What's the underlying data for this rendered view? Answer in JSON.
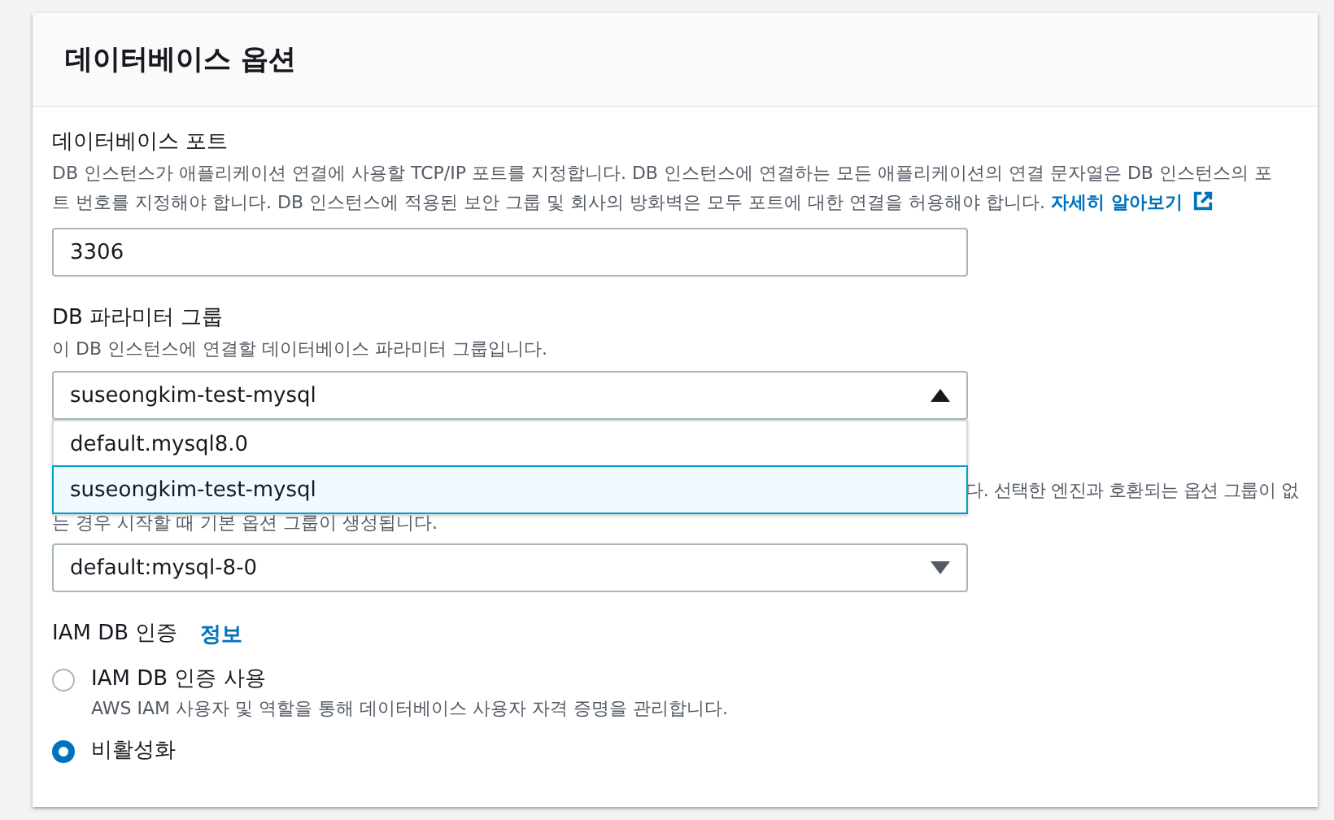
{
  "header": {
    "title": "데이터베이스 옵션"
  },
  "port": {
    "label": "데이터베이스 포트",
    "description": "DB 인스턴스가 애플리케이션 연결에 사용할 TCP/IP 포트를 지정합니다. DB 인스턴스에 연결하는 모든 애플리케이션의 연결 문자열은 DB 인스턴스의 포트 번호를 지정해야 합니다. DB 인스턴스에 적용된 보안 그룹 및 회사의 방화벽은 모두 포트에 대한 연결을 허용해야 합니다.",
    "link": "자세히 알아보기",
    "value": "3306"
  },
  "parameter_group": {
    "label": "DB 파라미터 그룹",
    "description": "이 DB 인스턴스에 연결할 데이터베이스 파라미터 그룹입니다.",
    "value": "suseongkim-test-mysql",
    "expanded": true,
    "options": [
      {
        "label": "default.mysql8.0",
        "selected": false
      },
      {
        "label": "suseongkim-test-mysql",
        "selected": true
      }
    ]
  },
  "option_group": {
    "description_fragments": [
      "다. 선택한 엔진과 호환되는 옵션 그룹이 없",
      "는 경우 시작할 때 기본 옵션 그룹이 생성됩니다."
    ],
    "value": "default:mysql-8-0",
    "expanded": false
  },
  "iam": {
    "label": "IAM DB 인증",
    "info_link": "정보",
    "options": [
      {
        "label": "IAM DB 인증 사용",
        "description": "AWS IAM 사용자 및 역할을 통해 데이터베이스 사용자 자격 증명을 관리합니다.",
        "selected": false
      },
      {
        "label": "비활성화",
        "selected": true
      }
    ]
  }
}
